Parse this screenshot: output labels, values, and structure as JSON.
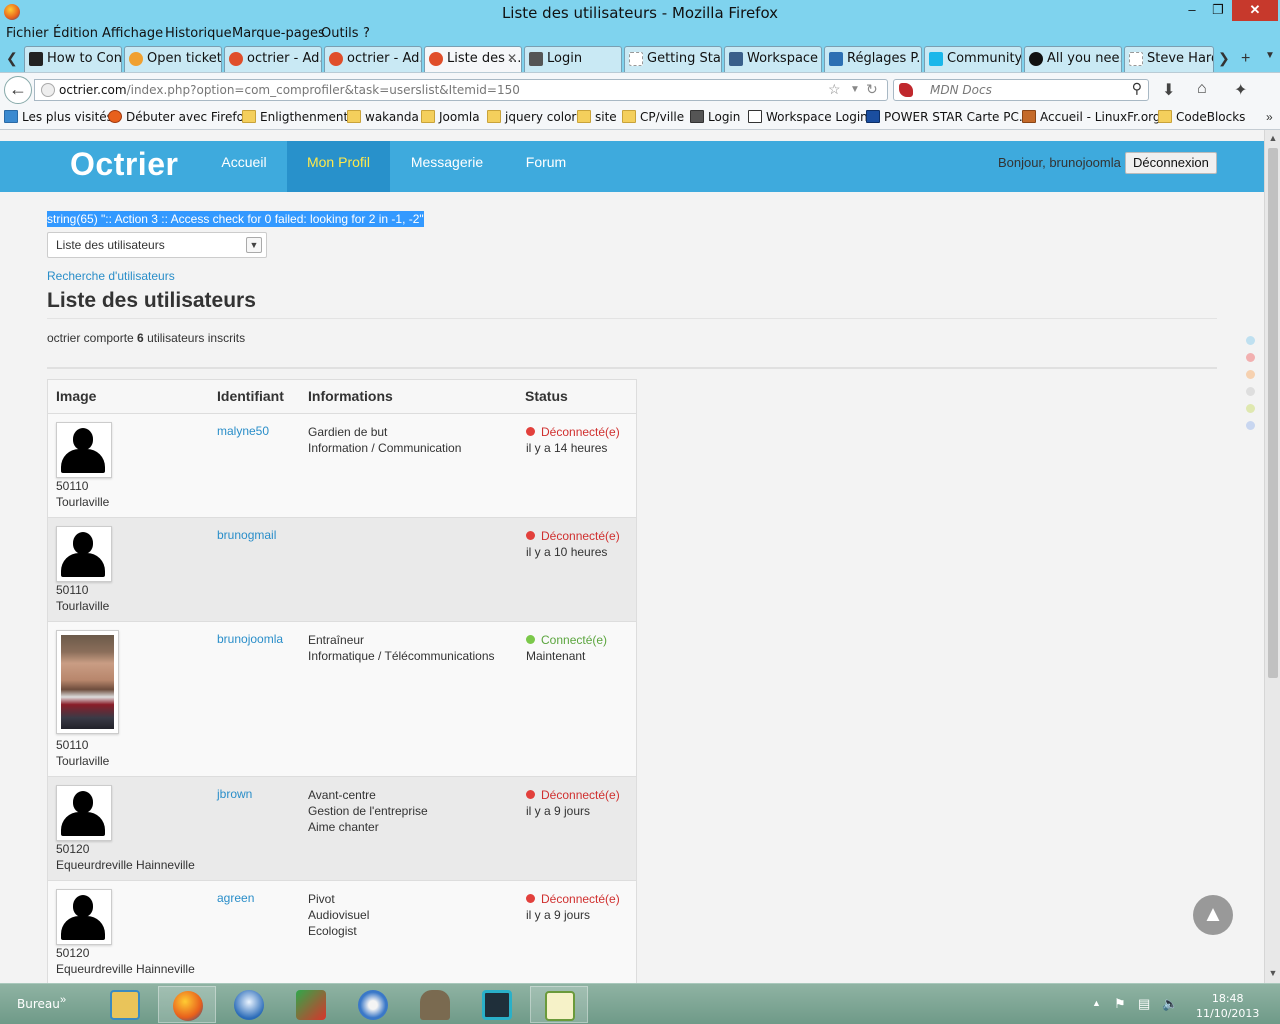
{
  "window": {
    "title": "Liste des utilisateurs - Mozilla Firefox"
  },
  "menu": [
    "Fichier",
    "Édition",
    "Affichage",
    "Historique",
    "Marque-pages",
    "Outils",
    "?"
  ],
  "tabs": [
    {
      "label": "How to Con...",
      "icon": "github-icon",
      "color": "#222222"
    },
    {
      "label": "Open ticket ...",
      "icon": "ticket-icon",
      "color": "#f0a030"
    },
    {
      "label": "octrier - Ad...",
      "icon": "joomla-icon",
      "color": "#e04e2a"
    },
    {
      "label": "octrier - Ad...",
      "icon": "joomla-icon",
      "color": "#e04e2a"
    },
    {
      "label": "Liste des ...",
      "icon": "joomla-icon",
      "color": "#e04e2a"
    },
    {
      "label": "Login",
      "icon": "page-icon",
      "color": "#555555"
    },
    {
      "label": "Getting Star...",
      "icon": "blank-icon",
      "color": "#dddddd"
    },
    {
      "label": "Workspace ...",
      "icon": "mail-icon",
      "color": "#3a5f8a"
    },
    {
      "label": "Réglages P...",
      "icon": "settings-icon",
      "color": "#2c6fb3"
    },
    {
      "label": "Community...",
      "icon": "vimeo-icon",
      "color": "#1ab7ea"
    },
    {
      "label": "All you nee...",
      "icon": "circle-icon",
      "color": "#111111"
    },
    {
      "label": "Steve Hardi...",
      "icon": "blank-icon",
      "color": "#dddddd"
    }
  ],
  "url": {
    "host": "octrier.com",
    "path": "/index.php?option=com_comprofiler&task=userslist&Itemid=150"
  },
  "search": {
    "placeholder": "MDN Docs"
  },
  "bookmarks": [
    "Les plus visités",
    "Débuter avec Firefox",
    "Enligthenment",
    "wakanda",
    "Joomla",
    "jquery color",
    "site",
    "CP/ville",
    "Login",
    "Workspace Login",
    "POWER STAR Carte PC...",
    "Accueil - LinuxFr.org",
    "CodeBlocks"
  ],
  "site": {
    "brand": "Octrier",
    "nav": [
      "Accueil",
      "Mon Profil",
      "Messagerie",
      "Forum"
    ],
    "active_nav": "Mon Profil",
    "greeting": "Bonjour, brunojoomla",
    "logout": "Déconnexion"
  },
  "page": {
    "debug": "string(65) \":: Action 3 :: Access check for 0 failed: looking for 2 in -1, -2\"",
    "list_select": "Liste des utilisateurs",
    "search_link": "Recherche d'utilisateurs",
    "title": "Liste des utilisateurs",
    "count_prefix": "octrier comporte",
    "count": "6",
    "count_suffix": "utilisateurs inscrits"
  },
  "table": {
    "headers": [
      "Image",
      "Identifiant",
      "Informations",
      "Status"
    ],
    "rows": [
      {
        "cp": "50110",
        "city": "Tourlaville",
        "username": "malyne50",
        "info": [
          "Gardien de but",
          "Information / Communication"
        ],
        "status": "Déconnecté(e)",
        "online": false,
        "ago": "il y a 14 heures"
      },
      {
        "cp": "50110",
        "city": "Tourlaville",
        "username": "brunogmail",
        "info": [],
        "status": "Déconnecté(e)",
        "online": false,
        "ago": "il y a 10 heures"
      },
      {
        "cp": "50110",
        "city": "Tourlaville",
        "username": "brunojoomla",
        "info": [
          "Entraîneur",
          "Informatique / Télécommunications"
        ],
        "status": "Connecté(e)",
        "online": true,
        "ago": "Maintenant"
      },
      {
        "cp": "50120",
        "city": "Equeurdreville Hainneville",
        "username": "jbrown",
        "info": [
          "Avant-centre",
          "Gestion de l'entreprise",
          "Aime chanter"
        ],
        "status": "Déconnecté(e)",
        "online": false,
        "ago": "il y a 9 jours"
      },
      {
        "cp": "50120",
        "city": "Equeurdreville Hainneville",
        "username": "agreen",
        "info": [
          "Pivot",
          "Audiovisuel",
          "Ecologist"
        ],
        "status": "Déconnecté(e)",
        "online": false,
        "ago": "il y a 9 jours"
      }
    ]
  },
  "taskbar": {
    "label": "Bureau",
    "time": "18:48",
    "date": "11/10/2013"
  },
  "colors": {
    "accent": "#3eaadd",
    "nav_active": "#2891cb",
    "link": "#2a8ec9",
    "offline": "#d0302f",
    "online": "#5ba53e"
  }
}
